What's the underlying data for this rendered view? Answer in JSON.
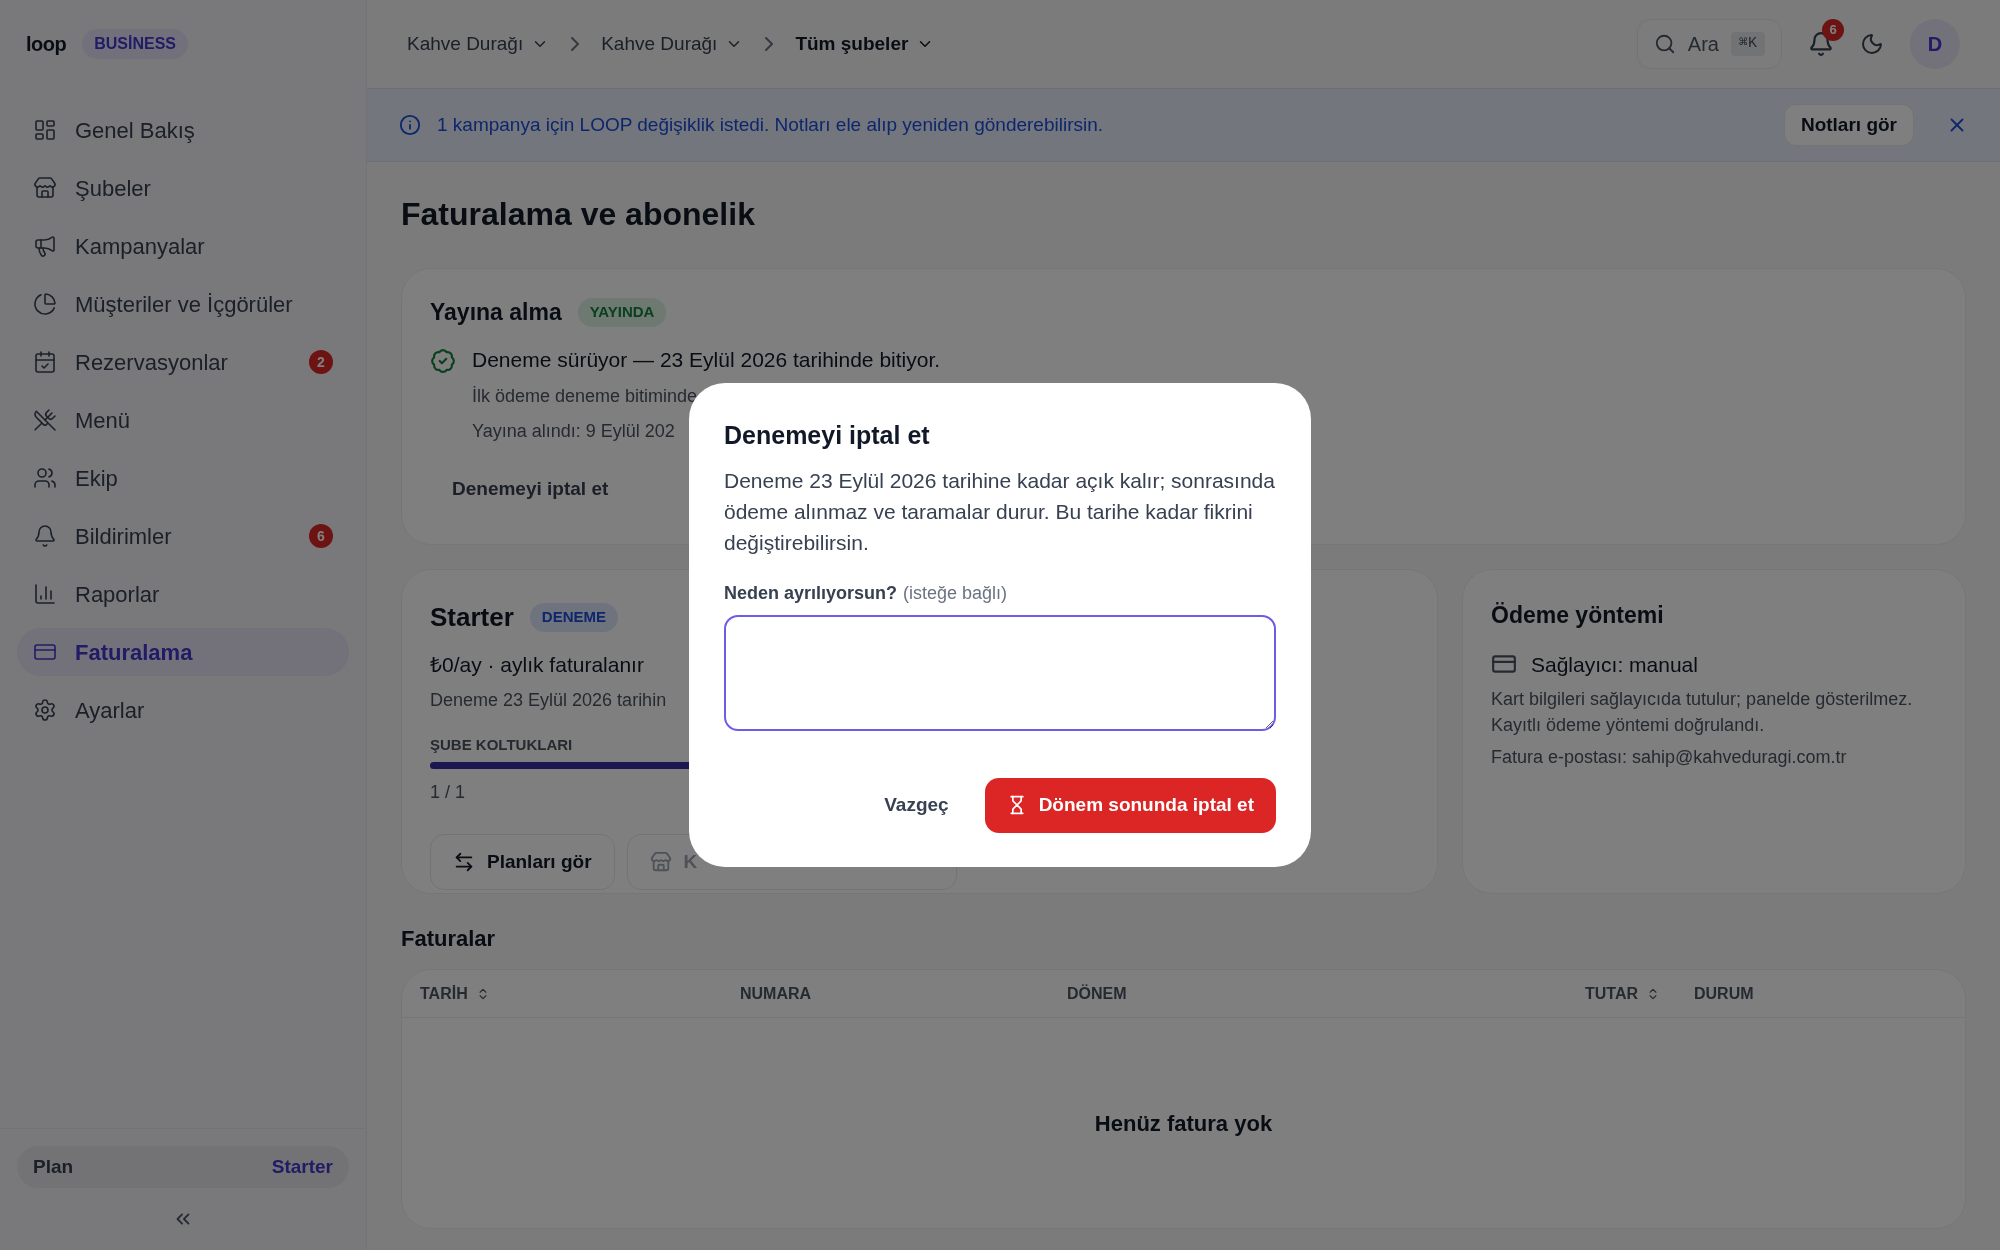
{
  "brand": {
    "logo": "loop",
    "badge": "BUSİNESS"
  },
  "sidebar": {
    "items": [
      {
        "label": "Genel Bakış",
        "selected": false
      },
      {
        "label": "Şubeler",
        "selected": false
      },
      {
        "label": "Kampanyalar",
        "selected": false
      },
      {
        "label": "Müşteriler ve İçgörüler",
        "selected": false
      },
      {
        "label": "Rezervasyonlar",
        "selected": false,
        "badge": "2"
      },
      {
        "label": "Menü",
        "selected": false
      },
      {
        "label": "Ekip",
        "selected": false
      },
      {
        "label": "Bildirimler",
        "selected": false,
        "badge": "6"
      },
      {
        "label": "Raporlar",
        "selected": false
      },
      {
        "label": "Faturalama",
        "selected": true
      },
      {
        "label": "Ayarlar",
        "selected": false
      }
    ],
    "plan": {
      "label": "Plan",
      "value": "Starter"
    }
  },
  "breadcrumb": [
    {
      "label": "Kahve Durağı",
      "current": false
    },
    {
      "label": "Kahve Durağı",
      "current": false
    },
    {
      "label": "Tüm şubeler",
      "current": true
    }
  ],
  "topbar": {
    "search": {
      "label": "Ara",
      "shortcut": "⌘K"
    },
    "notification_count": "6",
    "avatar": "D"
  },
  "banner": {
    "text": "1 kampanya için LOOP değişiklik istedi. Notları ele alıp yeniden gönderebilirsin.",
    "button": "Notları gör"
  },
  "page_title": "Faturalama ve abonelik",
  "go_live": {
    "title": "Yayına alma",
    "status": "YAYINDA",
    "headline": "Deneme sürüyor — 23 Eylül 2026 tarihinde bitiyor.",
    "lines": [
      "İlk ödeme deneme bitiminde",
      "Yayına alındı: 9 Eylül 202"
    ],
    "button": "Denemeyi iptal et"
  },
  "plan_card": {
    "name": "Starter",
    "badge": "DENEME",
    "price": "₺0/ay · aylık faturalanır",
    "trial_note": "Deneme 23 Eylül 2026 tarihin",
    "seats_label": "ŞUBE KOLTUKLARI",
    "level": 1,
    "seats_reading": "1 / 1",
    "buttons": [
      {
        "label": "Planları gör",
        "disabled": false
      },
      {
        "label": "K",
        "disabled": true
      }
    ]
  },
  "payment": {
    "title": "Ödeme yöntemi",
    "provider": "Sağlayıcı: manual",
    "note": "Kart bilgileri sağlayıcıda tutulur; panelde gösterilmez. Kayıtlı ödeme yöntemi doğrulandı.",
    "email": "Fatura e-postası: sahip@kahveduragi.com.tr"
  },
  "invoices": {
    "title": "Faturalar",
    "columns": [
      {
        "label": "TARİH",
        "sortable": true
      },
      {
        "label": "NUMARA",
        "sortable": false
      },
      {
        "label": "DÖNEM",
        "sortable": false
      },
      {
        "label": "TUTAR",
        "sortable": true
      },
      {
        "label": "DURUM",
        "sortable": false
      }
    ],
    "empty": "Henüz fatura yok"
  },
  "dialog": {
    "title": "Denemeyi iptal et",
    "body": "Deneme 23 Eylül 2026 tarihine kadar açık kalır; sonrasında ödeme alınmaz ve taramalar durur. Bu tarihe kadar fikrini değiştirebilirsin.",
    "field_label": "Neden ayrılıyorsun?",
    "field_hint": "(isteğe bağlı)",
    "cancel": "Vazgeç",
    "confirm": "Dönem sonunda iptal et"
  }
}
